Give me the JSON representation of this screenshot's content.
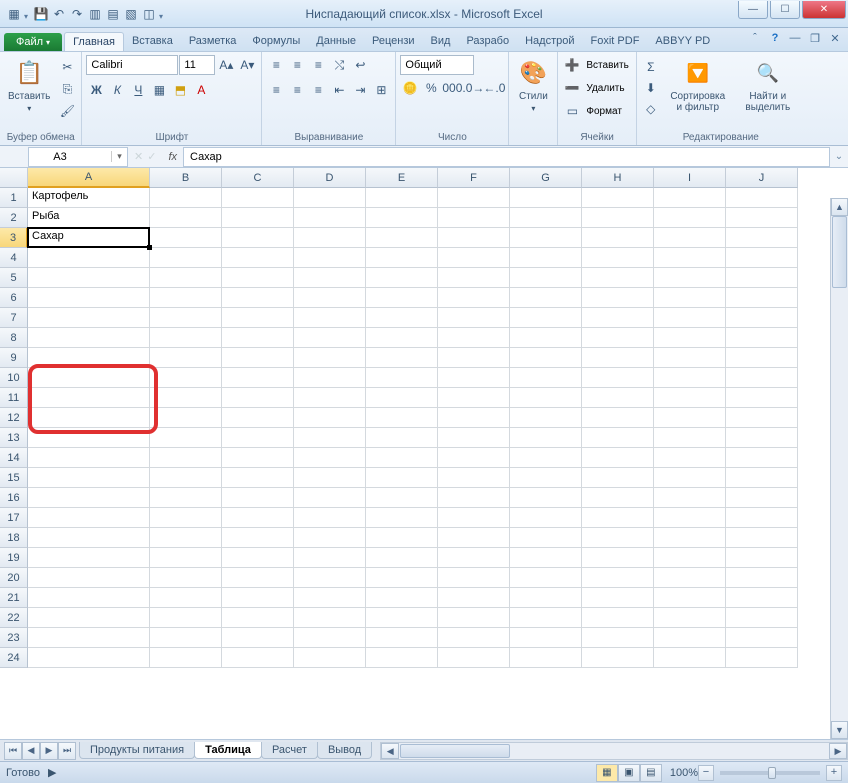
{
  "title": "Ниспадающий список.xlsx - Microsoft Excel",
  "qat": {
    "save": "💾",
    "undo": "↶",
    "redo": "↷"
  },
  "winbtns": {
    "min": "—",
    "max": "☐",
    "close": "✕"
  },
  "file_tab": "Файл",
  "tabs": [
    "Главная",
    "Вставка",
    "Разметка",
    "Формулы",
    "Данные",
    "Рецензи",
    "Вид",
    "Разрабо",
    "Надстрой",
    "Foxit PDF",
    "ABBYY PD"
  ],
  "ribbon": {
    "clipboard": {
      "paste": "Вставить",
      "label": "Буфер обмена"
    },
    "font": {
      "name": "Calibri",
      "size": "11",
      "label": "Шрифт",
      "bold": "Ж",
      "italic": "К",
      "underline": "Ч"
    },
    "align": {
      "label": "Выравнивание"
    },
    "number": {
      "format": "Общий",
      "label": "Число"
    },
    "styles": {
      "btn": "Стили",
      "label": ""
    },
    "cells": {
      "insert": "Вставить",
      "delete": "Удалить",
      "format": "Формат",
      "label": "Ячейки"
    },
    "editing": {
      "sort": "Сортировка и фильтр",
      "find": "Найти и выделить",
      "label": "Редактирование"
    }
  },
  "name_box": "A3",
  "formula": "Сахар",
  "columns": [
    "A",
    "B",
    "C",
    "D",
    "E",
    "F",
    "G",
    "H",
    "I",
    "J"
  ],
  "row_count": 24,
  "cells": {
    "A1": "Картофель",
    "A2": "Рыба",
    "A3": "Сахар"
  },
  "active_cell": {
    "row": 3,
    "col": "A"
  },
  "sheet_tabs": [
    "Продукты питания",
    "Таблица",
    "Расчет",
    "Вывод"
  ],
  "active_sheet": 1,
  "status": {
    "ready": "Готово",
    "zoom": "100%"
  }
}
